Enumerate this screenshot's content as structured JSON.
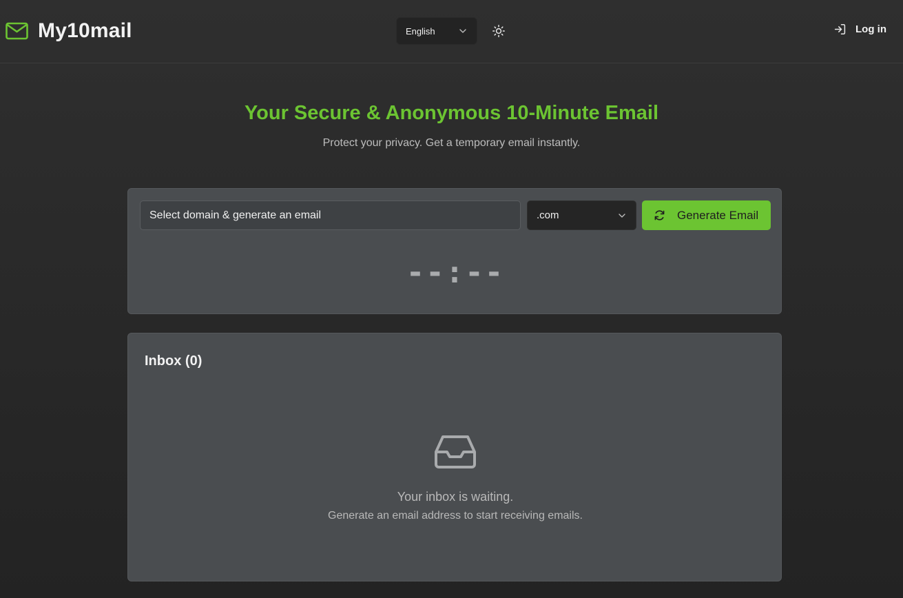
{
  "app": {
    "name": "My10mail"
  },
  "header": {
    "language": "English",
    "login_label": "Log in",
    "icons": {
      "logo": "mail-icon",
      "theme": "sun-icon",
      "login": "log-in-icon",
      "dropdown": "chevron-down-icon"
    }
  },
  "hero": {
    "title": "Your Secure & Anonymous 10-Minute Email",
    "subtitle": "Protect your privacy. Get a temporary email instantly."
  },
  "generator": {
    "placeholder": "Select domain & generate an email",
    "domain": ".com",
    "button_label": "Generate Email",
    "button_icon": "refresh-icon",
    "timer": "--:--"
  },
  "inbox": {
    "title": "Inbox",
    "count": "(0)",
    "icon": "inbox-icon",
    "empty_title": "Your inbox is waiting.",
    "empty_hint": "Generate an email address to start receiving emails."
  },
  "colors": {
    "accent": "#6cc432",
    "background": "#2a2a2a",
    "card": "#4a4d50"
  }
}
